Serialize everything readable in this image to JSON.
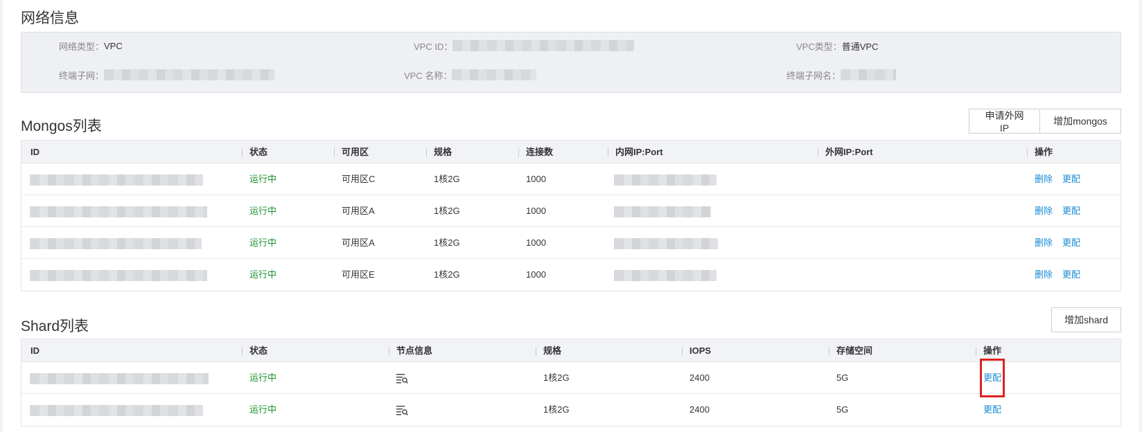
{
  "network": {
    "title": "网络信息",
    "net_type_label": "网络类型：",
    "net_type_value": "VPC",
    "vpc_id_label": "VPC ID：",
    "vpc_type_label": "VPC类型：",
    "vpc_type_value": "普通VPC",
    "subnet_label": "终端子网：",
    "vpc_name_label": "VPC 名称：",
    "subnet_name_label": "终端子网名："
  },
  "mongos": {
    "title": "Mongos列表",
    "buttons": {
      "apply_ip": "申请外网IP",
      "add": "增加mongos"
    },
    "headers": [
      "ID",
      "状态",
      "可用区",
      "规格",
      "连接数",
      "内网IP:Port",
      "外网IP:Port",
      "操作"
    ],
    "rows": [
      {
        "status": "运行中",
        "zone": "可用区C",
        "spec": "1核2G",
        "conn": "1000",
        "op_delete": "删除",
        "op_config": "更配"
      },
      {
        "status": "运行中",
        "zone": "可用区A",
        "spec": "1核2G",
        "conn": "1000",
        "op_delete": "删除",
        "op_config": "更配"
      },
      {
        "status": "运行中",
        "zone": "可用区A",
        "spec": "1核2G",
        "conn": "1000",
        "op_delete": "删除",
        "op_config": "更配"
      },
      {
        "status": "运行中",
        "zone": "可用区E",
        "spec": "1核2G",
        "conn": "1000",
        "op_delete": "删除",
        "op_config": "更配"
      }
    ]
  },
  "shard": {
    "title": "Shard列表",
    "buttons": {
      "add": "增加shard"
    },
    "headers": [
      "ID",
      "状态",
      "节点信息",
      "规格",
      "IOPS",
      "存储空间",
      "操作"
    ],
    "rows": [
      {
        "status": "运行中",
        "node_icon": "node-list-search-icon",
        "spec": "1核2G",
        "iops": "2400",
        "storage": "5G",
        "op_config": "更配",
        "highlighted": true
      },
      {
        "status": "运行中",
        "node_icon": "node-list-search-icon",
        "spec": "1核2G",
        "iops": "2400",
        "storage": "5G",
        "op_config": "更配",
        "highlighted": false
      }
    ]
  },
  "colors": {
    "status_running": "#1a8f2d",
    "link": "#1a8bd6",
    "highlight": "#e02020",
    "header_bg": "#f2f3f7",
    "info_bg": "#eff0f4"
  }
}
